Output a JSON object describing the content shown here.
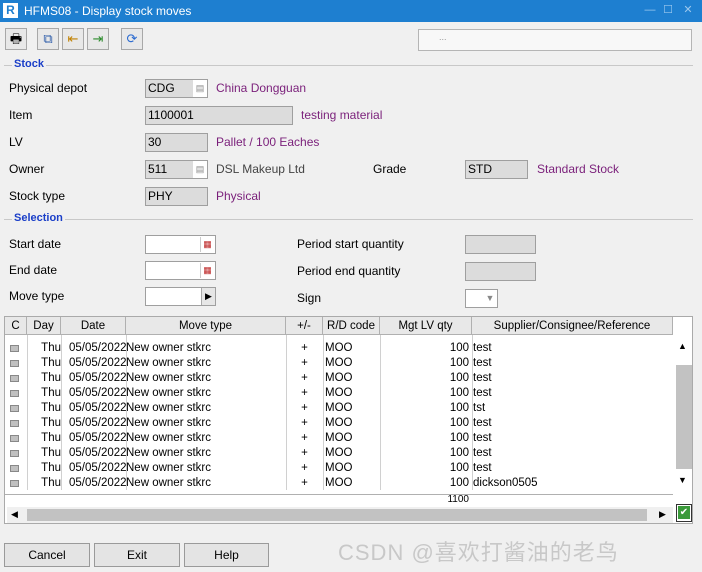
{
  "window": {
    "title": "HFMS08 - Display stock moves",
    "logo": "R"
  },
  "toolbar": {
    "icons": [
      "print-icon",
      "copy-icon",
      "first-icon",
      "last-icon",
      "refresh-icon"
    ]
  },
  "top_box": {
    "text": "..."
  },
  "stock": {
    "group_label": "Stock",
    "physical_depot_label": "Physical depot",
    "physical_depot_value": "CDG",
    "physical_depot_desc": "China Dongguan",
    "item_label": "Item",
    "item_value": "1100001",
    "item_desc": "testing material",
    "lv_label": "LV",
    "lv_value": "30",
    "lv_desc": "Pallet / 100 Eaches",
    "owner_label": "Owner",
    "owner_value": "511",
    "owner_desc": "DSL Makeup Ltd",
    "grade_label": "Grade",
    "grade_value": "STD",
    "grade_desc": "Standard Stock",
    "stock_type_label": "Stock type",
    "stock_type_value": "PHY",
    "stock_type_desc": "Physical"
  },
  "selection": {
    "group_label": "Selection",
    "start_date_label": "Start date",
    "end_date_label": "End date",
    "move_type_label": "Move type",
    "period_start_label": "Period start quantity",
    "period_end_label": "Period end quantity",
    "sign_label": "Sign"
  },
  "grid": {
    "headers": [
      "C",
      "Day",
      "Date",
      "Move type",
      "+/-",
      "R/D code",
      "Mgt LV qty",
      "Supplier/Consignee/Reference"
    ],
    "rows": [
      {
        "day": "Thu",
        "date": "05/05/2022",
        "move_type": "New owner stkrc",
        "sign": "+",
        "rd": "MOO",
        "qty": "100",
        "ref": "test"
      },
      {
        "day": "Thu",
        "date": "05/05/2022",
        "move_type": "New owner stkrc",
        "sign": "+",
        "rd": "MOO",
        "qty": "100",
        "ref": "test"
      },
      {
        "day": "Thu",
        "date": "05/05/2022",
        "move_type": "New owner stkrc",
        "sign": "+",
        "rd": "MOO",
        "qty": "100",
        "ref": "test"
      },
      {
        "day": "Thu",
        "date": "05/05/2022",
        "move_type": "New owner stkrc",
        "sign": "+",
        "rd": "MOO",
        "qty": "100",
        "ref": "test"
      },
      {
        "day": "Thu",
        "date": "05/05/2022",
        "move_type": "New owner stkrc",
        "sign": "+",
        "rd": "MOO",
        "qty": "100",
        "ref": "tst"
      },
      {
        "day": "Thu",
        "date": "05/05/2022",
        "move_type": "New owner stkrc",
        "sign": "+",
        "rd": "MOO",
        "qty": "100",
        "ref": "test"
      },
      {
        "day": "Thu",
        "date": "05/05/2022",
        "move_type": "New owner stkrc",
        "sign": "+",
        "rd": "MOO",
        "qty": "100",
        "ref": "test"
      },
      {
        "day": "Thu",
        "date": "05/05/2022",
        "move_type": "New owner stkrc",
        "sign": "+",
        "rd": "MOO",
        "qty": "100",
        "ref": "test"
      },
      {
        "day": "Thu",
        "date": "05/05/2022",
        "move_type": "New owner stkrc",
        "sign": "+",
        "rd": "MOO",
        "qty": "100",
        "ref": "test"
      },
      {
        "day": "Thu",
        "date": "05/05/2022",
        "move_type": "New owner stkrc",
        "sign": "+",
        "rd": "MOO",
        "qty": "100",
        "ref": "dickson0505"
      }
    ],
    "total": "1100"
  },
  "buttons": {
    "cancel": "Cancel",
    "exit": "Exit",
    "help": "Help"
  },
  "watermark": "CSDN @喜欢打酱油的老鸟",
  "colors": {
    "title_bar": "#1e7fd0",
    "group_label": "#1a3ec8",
    "description": "#7a1f7a"
  }
}
